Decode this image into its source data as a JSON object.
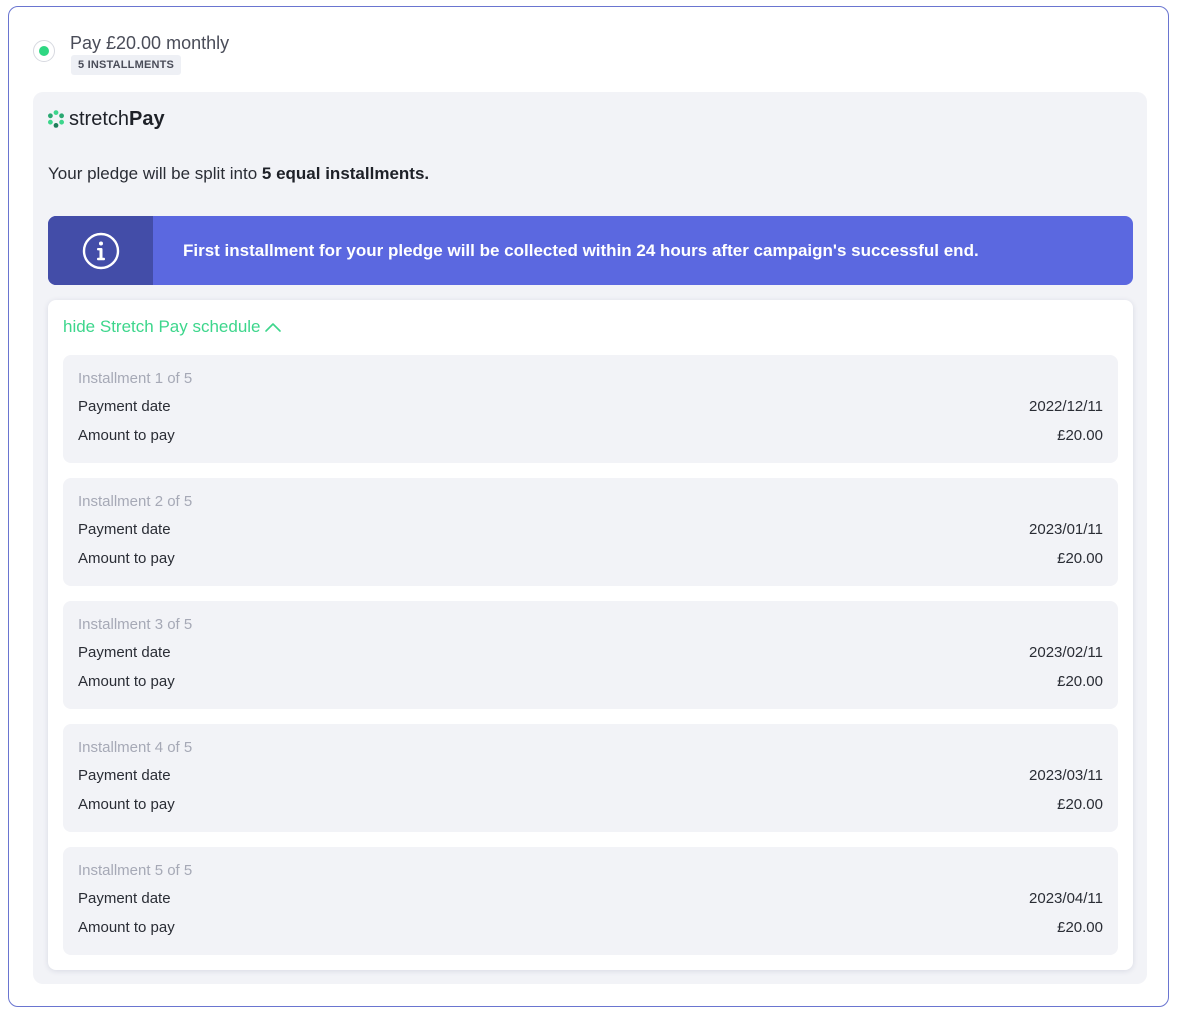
{
  "option": {
    "title": "Pay £20.00 monthly",
    "badge": "5 INSTALLMENTS",
    "selected": true
  },
  "brand": {
    "logo_light": "stretch",
    "logo_bold": "Pay",
    "colors": {
      "accent_green": "#3dd68c",
      "banner_blue": "#5b68e0",
      "banner_icon_bg": "#434da8",
      "border": "#6a75d0"
    }
  },
  "summary": {
    "prefix": "Your pledge will be split into ",
    "emphasis": "5 equal installments."
  },
  "notice": {
    "icon": "info-icon",
    "text": "First installment for your pledge will be collected within 24 hours after campaign's successful end."
  },
  "schedule": {
    "toggle_label": "hide Stretch Pay schedule",
    "toggle_icon": "chevron-up-icon",
    "installments": [
      {
        "title": "Installment 1 of 5",
        "date_label": "Payment date",
        "date": "2022/12/11",
        "amount_label": "Amount to pay",
        "amount": "£20.00"
      },
      {
        "title": "Installment 2 of 5",
        "date_label": "Payment date",
        "date": "2023/01/11",
        "amount_label": "Amount to pay",
        "amount": "£20.00"
      },
      {
        "title": "Installment 3 of 5",
        "date_label": "Payment date",
        "date": "2023/02/11",
        "amount_label": "Amount to pay",
        "amount": "£20.00"
      },
      {
        "title": "Installment 4 of 5",
        "date_label": "Payment date",
        "date": "2023/03/11",
        "amount_label": "Amount to pay",
        "amount": "£20.00"
      },
      {
        "title": "Installment 5 of 5",
        "date_label": "Payment date",
        "date": "2023/04/11",
        "amount_label": "Amount to pay",
        "amount": "£20.00"
      }
    ]
  }
}
